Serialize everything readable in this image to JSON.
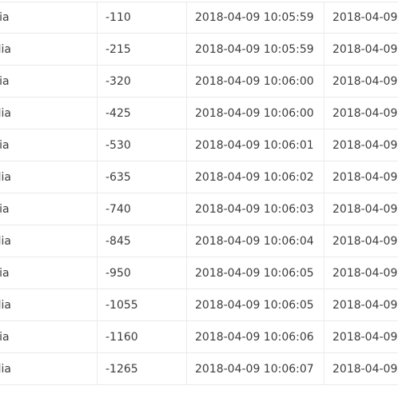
{
  "table": {
    "rows": [
      {
        "country": "Slovenia",
        "value": "-110",
        "time1": "2018-04-09 10:05:59",
        "time2": "2018-04-09"
      },
      {
        "country": "Australia",
        "value": "-215",
        "time1": "2018-04-09 10:05:59",
        "time2": "2018-04-09"
      },
      {
        "country": "Slovenia",
        "value": "-320",
        "time1": "2018-04-09 10:06:00",
        "time2": "2018-04-09"
      },
      {
        "country": "Australia",
        "value": "-425",
        "time1": "2018-04-09 10:06:00",
        "time2": "2018-04-09"
      },
      {
        "country": "Slovenia",
        "value": "-530",
        "time1": "2018-04-09 10:06:01",
        "time2": "2018-04-09"
      },
      {
        "country": "Australia",
        "value": "-635",
        "time1": "2018-04-09 10:06:02",
        "time2": "2018-04-09"
      },
      {
        "country": "Slovenia",
        "value": "-740",
        "time1": "2018-04-09 10:06:03",
        "time2": "2018-04-09"
      },
      {
        "country": "Australia",
        "value": "-845",
        "time1": "2018-04-09 10:06:04",
        "time2": "2018-04-09"
      },
      {
        "country": "Slovenia",
        "value": "-950",
        "time1": "2018-04-09 10:06:05",
        "time2": "2018-04-09"
      },
      {
        "country": "Australia",
        "value": "-1055",
        "time1": "2018-04-09 10:06:05",
        "time2": "2018-04-09"
      },
      {
        "country": "Slovenia",
        "value": "-1160",
        "time1": "2018-04-09 10:06:06",
        "time2": "2018-04-09"
      },
      {
        "country": "Australia",
        "value": "-1265",
        "time1": "2018-04-09 10:06:07",
        "time2": "2018-04-09"
      }
    ]
  }
}
